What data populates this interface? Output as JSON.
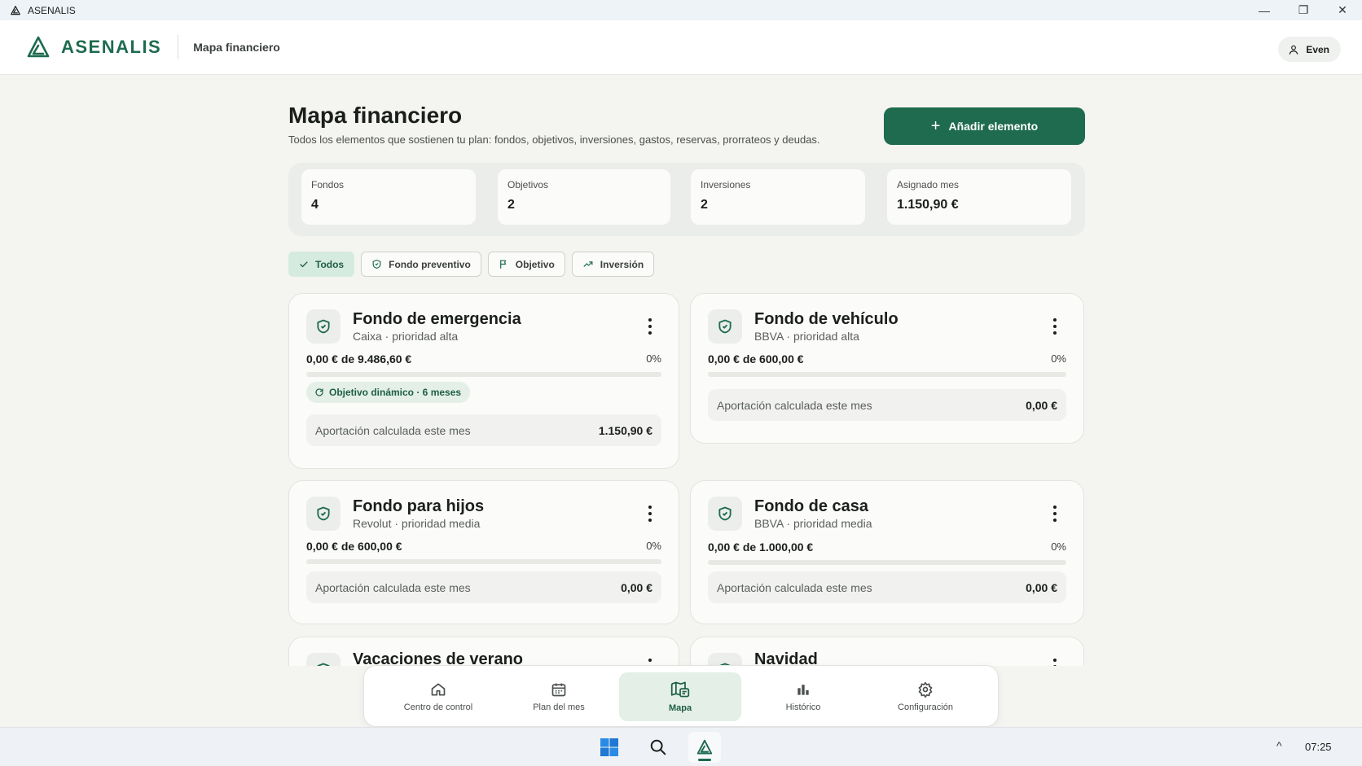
{
  "window": {
    "title": "ASENALIS",
    "minimize": "—",
    "maximize": "❐",
    "close": "✕"
  },
  "header": {
    "brand": "ASENALIS",
    "page": "Mapa financiero",
    "user": "Even"
  },
  "page": {
    "title": "Mapa financiero",
    "subtitle": "Todos los elementos que sostienen tu plan: fondos, objetivos, inversiones, gastos, reservas, prorrateos y deudas.",
    "add_button": "Añadir elemento",
    "add_plus": "+"
  },
  "stats": [
    {
      "label": "Fondos",
      "value": "4"
    },
    {
      "label": "Objetivos",
      "value": "2"
    },
    {
      "label": "Inversiones",
      "value": "2"
    },
    {
      "label": "Asignado mes",
      "value": "1.150,90 €"
    }
  ],
  "filters": [
    {
      "label": "Todos",
      "icon": "check-icon",
      "active": true
    },
    {
      "label": "Fondo preventivo",
      "icon": "shield-icon",
      "active": false
    },
    {
      "label": "Objetivo",
      "icon": "flag-icon",
      "active": false
    },
    {
      "label": "Inversión",
      "icon": "trending-up-icon",
      "active": false
    }
  ],
  "cards": [
    {
      "title": "Fondo de emergencia",
      "subtitle": "Caixa · prioridad alta",
      "progress": "0,00 € de 9.486,60 €",
      "percent": "0%",
      "progress_fraction": 0,
      "badge": "Objetivo dinámico · 6 meses",
      "contrib_label": "Aportación calculada este mes",
      "contrib_value": "1.150,90 €"
    },
    {
      "title": "Fondo de vehículo",
      "subtitle": "BBVA · prioridad alta",
      "progress": "0,00 € de 600,00 €",
      "percent": "0%",
      "progress_fraction": 0,
      "contrib_label": "Aportación calculada este mes",
      "contrib_value": "0,00 €"
    },
    {
      "title": "Fondo para hijos",
      "subtitle": "Revolut · prioridad media",
      "progress": "0,00 € de 600,00 €",
      "percent": "0%",
      "progress_fraction": 0,
      "contrib_label": "Aportación calculada este mes",
      "contrib_value": "0,00 €"
    },
    {
      "title": "Fondo de casa",
      "subtitle": "BBVA · prioridad media",
      "progress": "0,00 € de 1.000,00 €",
      "percent": "0%",
      "progress_fraction": 0,
      "contrib_label": "Aportación calculada este mes",
      "contrib_value": "0,00 €"
    },
    {
      "title": "Vacaciones de verano"
    },
    {
      "title": "Navidad"
    }
  ],
  "nav": [
    {
      "label": "Centro de control",
      "icon": "home-icon",
      "active": false
    },
    {
      "label": "Plan del mes",
      "icon": "calendar-icon",
      "active": false
    },
    {
      "label": "Mapa",
      "icon": "map-icon",
      "active": true
    },
    {
      "label": "Histórico",
      "icon": "bar-chart-icon",
      "active": false
    },
    {
      "label": "Configuración",
      "icon": "gear-icon",
      "active": false
    }
  ],
  "taskbar": {
    "clock": "07:25",
    "tray_chevron": "^"
  },
  "colors": {
    "brand": "#1e6b4f",
    "accent_light": "#e3efe7",
    "background": "#f4f4f1"
  }
}
